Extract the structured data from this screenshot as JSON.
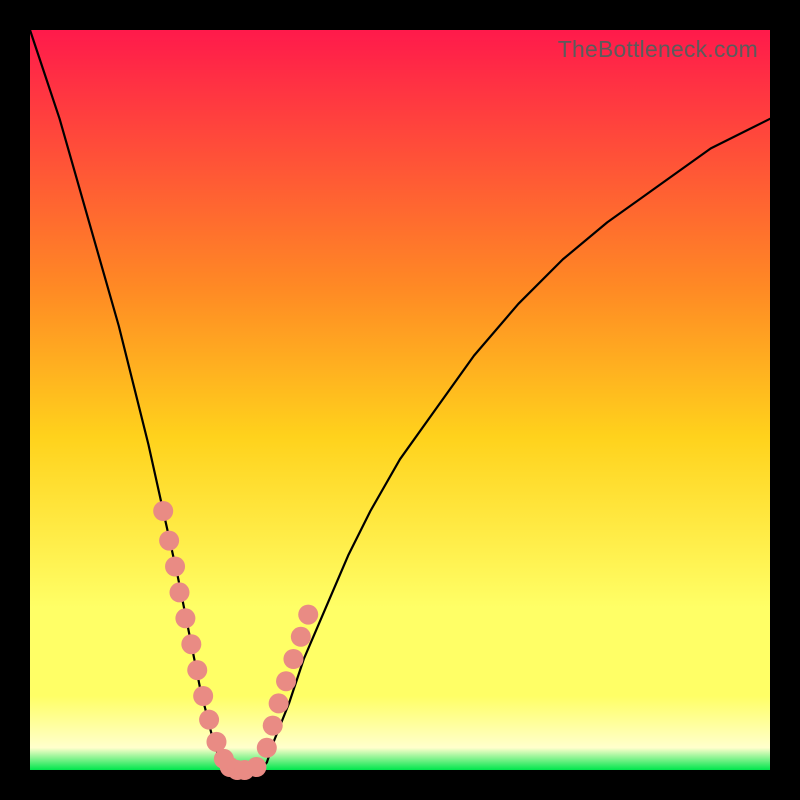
{
  "watermark": "TheBottleneck.com",
  "colors": {
    "border": "#000000",
    "gradient_top": "#ff1a4b",
    "gradient_mid_upper": "#ff8a24",
    "gradient_mid": "#ffd21c",
    "gradient_lower": "#ffff66",
    "gradient_pale": "#ffffcc",
    "gradient_bottom": "#00e64d",
    "curve": "#000000",
    "marker_fill": "#e98b84",
    "marker_stroke": "#b04e4e"
  },
  "chart_data": {
    "type": "line",
    "title": "",
    "xlabel": "",
    "ylabel": "",
    "xlim": [
      0,
      100
    ],
    "ylim": [
      0,
      100
    ],
    "x": [
      0,
      2,
      4,
      6,
      8,
      10,
      12,
      14,
      16,
      18,
      20,
      21,
      22,
      23,
      24,
      25,
      26,
      27,
      28,
      29,
      30,
      31,
      32,
      33,
      35,
      37,
      40,
      43,
      46,
      50,
      55,
      60,
      66,
      72,
      78,
      85,
      92,
      100
    ],
    "y": [
      100,
      94,
      88,
      81,
      74,
      67,
      60,
      52,
      44,
      35,
      26,
      21,
      16,
      11,
      7,
      3,
      1,
      0,
      0,
      0,
      0,
      0,
      1,
      4,
      9,
      15,
      22,
      29,
      35,
      42,
      49,
      56,
      63,
      69,
      74,
      79,
      84,
      88
    ],
    "markers": {
      "x": [
        18.0,
        18.8,
        19.6,
        20.2,
        21.0,
        21.8,
        22.6,
        23.4,
        24.2,
        25.2,
        26.2,
        27.0,
        28.0,
        29.0,
        30.6,
        32.0,
        32.8,
        33.6,
        34.6,
        35.6,
        36.6,
        37.6
      ],
      "y": [
        35.0,
        31.0,
        27.5,
        24.0,
        20.5,
        17.0,
        13.5,
        10.0,
        6.8,
        3.8,
        1.5,
        0.4,
        0.0,
        0.0,
        0.4,
        3.0,
        6.0,
        9.0,
        12.0,
        15.0,
        18.0,
        21.0
      ]
    }
  }
}
